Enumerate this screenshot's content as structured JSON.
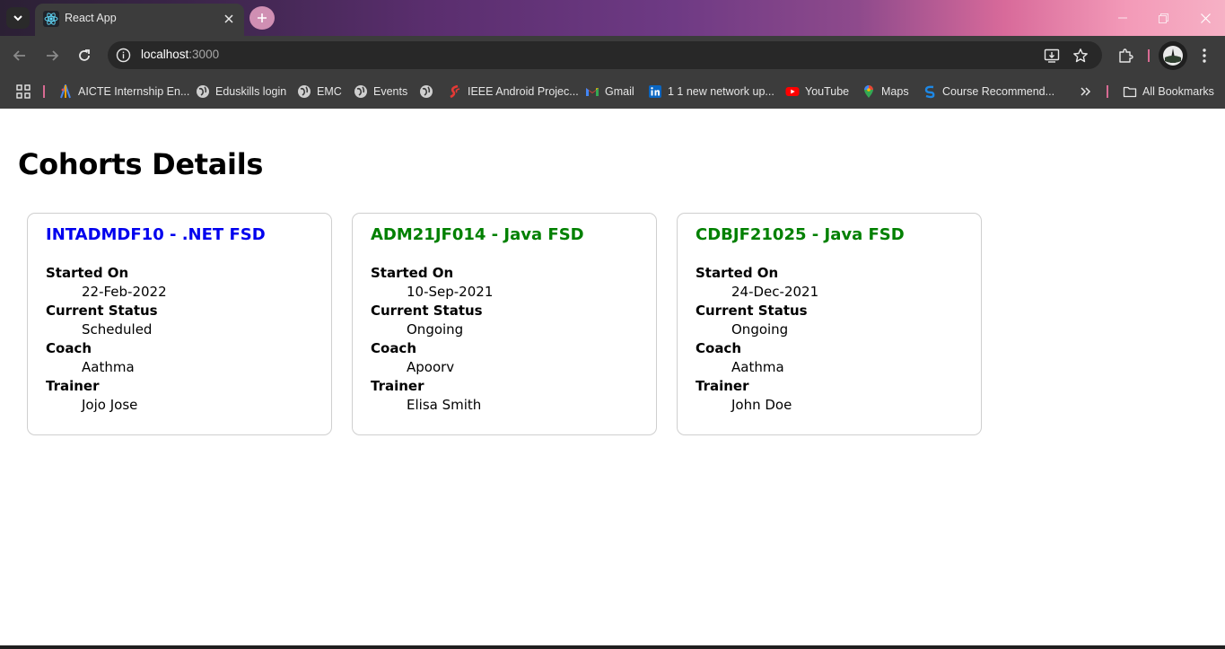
{
  "browser": {
    "tab_title": "React App",
    "url_host": "localhost",
    "url_port": ":3000",
    "bookmarks": [
      {
        "label": "AICTE Internship En...",
        "icon": "aicte-icon"
      },
      {
        "label": "Eduskills login",
        "icon": "globe-icon"
      },
      {
        "label": "EMC",
        "icon": "globe-icon"
      },
      {
        "label": "Events",
        "icon": "globe-icon"
      },
      {
        "label": "",
        "icon": "globe-icon"
      },
      {
        "label": "IEEE Android Projec...",
        "icon": "ieee-icon"
      },
      {
        "label": "Gmail",
        "icon": "gmail-icon"
      },
      {
        "label": "1 1 new network up...",
        "icon": "linkedin-icon"
      },
      {
        "label": "YouTube",
        "icon": "youtube-icon"
      },
      {
        "label": "Maps",
        "icon": "maps-icon"
      },
      {
        "label": "Course Recommend...",
        "icon": "course-icon"
      }
    ],
    "all_bookmarks_label": "All Bookmarks"
  },
  "page": {
    "title": "Cohorts Details",
    "field_labels": {
      "started_on": "Started On",
      "current_status": "Current Status",
      "coach": "Coach",
      "trainer": "Trainer"
    },
    "cohorts": [
      {
        "title": "INTADMDF10 - .NET FSD",
        "title_color": "#0000ee",
        "started_on": "22-Feb-2022",
        "current_status": "Scheduled",
        "coach": "Aathma",
        "trainer": "Jojo Jose"
      },
      {
        "title": "ADM21JF014 - Java FSD",
        "title_color": "#008000",
        "started_on": "10-Sep-2021",
        "current_status": "Ongoing",
        "coach": "Apoorv",
        "trainer": "Elisa Smith"
      },
      {
        "title": "CDBJF21025 - Java FSD",
        "title_color": "#008000",
        "started_on": "24-Dec-2021",
        "current_status": "Ongoing",
        "coach": "Aathma",
        "trainer": "John Doe"
      }
    ]
  }
}
